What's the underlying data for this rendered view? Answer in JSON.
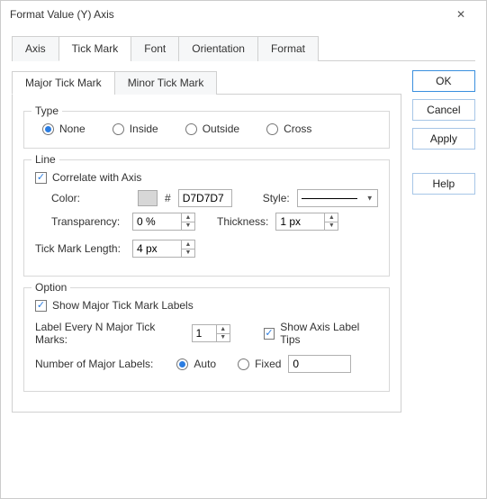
{
  "title": "Format Value (Y) Axis",
  "main_tabs": {
    "axis": "Axis",
    "tick": "Tick Mark",
    "font": "Font",
    "orient": "Orientation",
    "format": "Format"
  },
  "sub_tabs": {
    "major": "Major Tick Mark",
    "minor": "Minor Tick Mark"
  },
  "buttons": {
    "ok": "OK",
    "cancel": "Cancel",
    "apply": "Apply",
    "help": "Help"
  },
  "type": {
    "legend": "Type",
    "none": "None",
    "inside": "Inside",
    "outside": "Outside",
    "cross": "Cross"
  },
  "line": {
    "legend": "Line",
    "correlate": "Correlate with Axis",
    "color_label": "Color:",
    "hash": "#",
    "color_value": "D7D7D7",
    "style_label": "Style:",
    "transparency_label": "Transparency:",
    "transparency_value": "0 %",
    "thickness_label": "Thickness:",
    "thickness_value": "1 px",
    "length_label": "Tick Mark Length:",
    "length_value": "4 px"
  },
  "option": {
    "legend": "Option",
    "show_labels": "Show Major Tick Mark Labels",
    "label_every": "Label Every N Major Tick Marks:",
    "label_every_value": "1",
    "show_tips": "Show Axis Label Tips",
    "num_labels": "Number of Major Labels:",
    "auto": "Auto",
    "fixed": "Fixed",
    "fixed_value": "0"
  }
}
